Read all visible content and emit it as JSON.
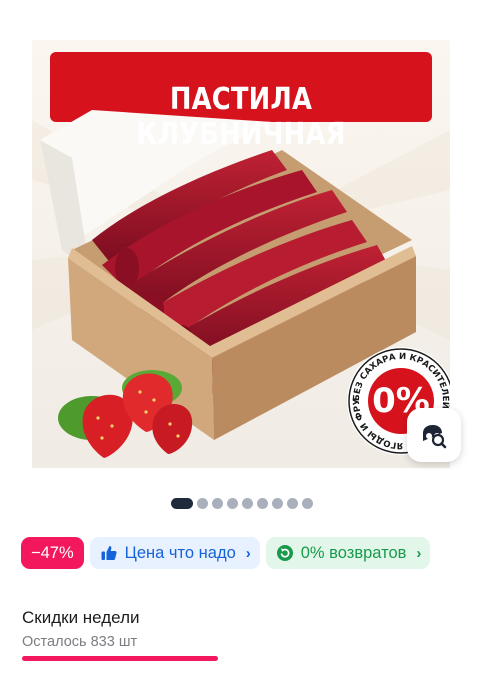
{
  "product_image": {
    "banner_title": "ПАСТИЛА КЛУБНИЧНАЯ",
    "badge_percent": "0%",
    "badge_ring_text": "БЕЗ САХАРА И КРАСИТЕЛЕЙ • ТОЛЬКО ЯГОДЫ И ФРУКТЫ •",
    "visual_search_icon": "visual-search-icon"
  },
  "pagination": {
    "total": 9,
    "active_index": 0
  },
  "chips": {
    "discount": "−47%",
    "price_label": "Цена что надо",
    "returns_label": "0% возвратов"
  },
  "promo": {
    "title": "Скидки недели",
    "remaining": "Осталось 833 шт",
    "progress_fraction": 0.43
  },
  "colors": {
    "accent": "#f3185d",
    "banner_red": "#d6121c",
    "price_blue": "#1662d8",
    "returns_green": "#179a4c"
  }
}
